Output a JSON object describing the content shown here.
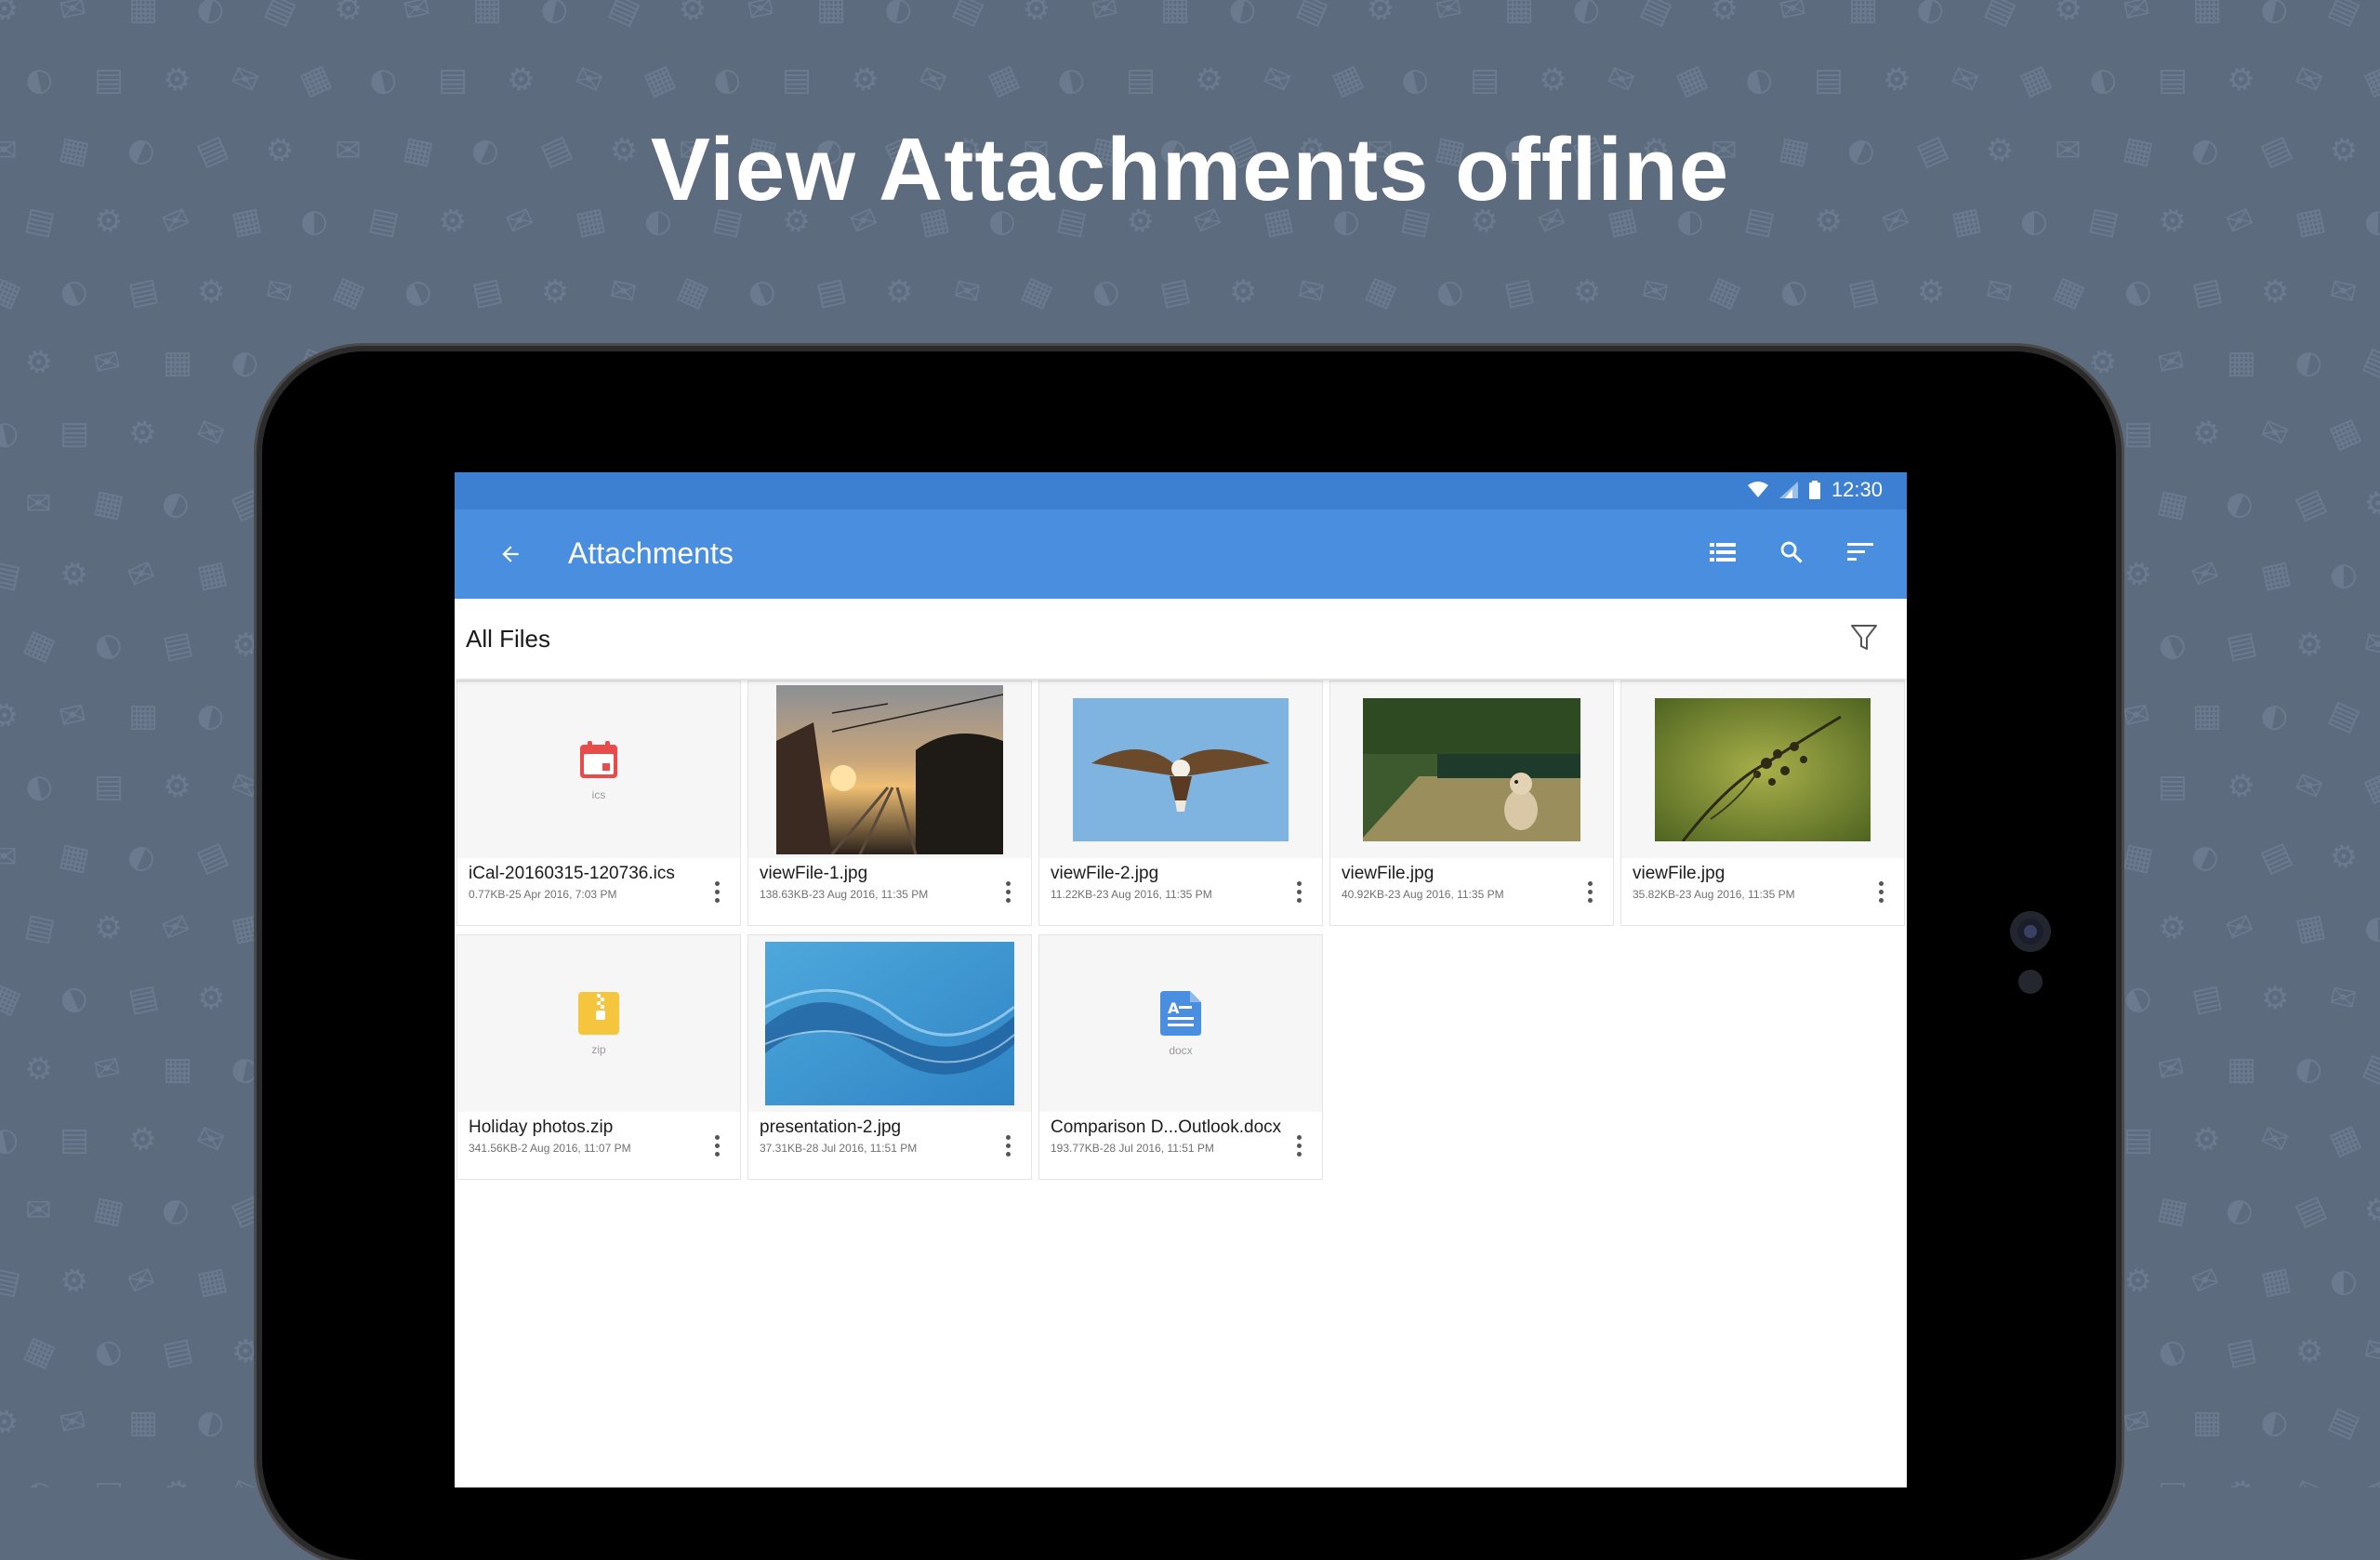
{
  "headline": "View Attachments offline",
  "status_bar": {
    "time": "12:30"
  },
  "app_bar": {
    "title": "Attachments",
    "icons": [
      "back-arrow-icon",
      "list-view-icon",
      "search-icon",
      "sort-icon"
    ]
  },
  "filter_bar": {
    "label": "All Files",
    "icon": "filter-icon"
  },
  "files": [
    {
      "name": "iCal-20160315-120736.ics",
      "meta": "0.77KB-25 Apr 2016, 7:03 PM",
      "kind": "icon",
      "ext": "ics",
      "icon": "calendar-icon",
      "color": "#e94b4b"
    },
    {
      "name": "viewFile-1.jpg",
      "meta": "138.63KB-23 Aug 2016, 11:35 PM",
      "kind": "image",
      "image": "sunset-railway"
    },
    {
      "name": "viewFile-2.jpg",
      "meta": "11.22KB-23 Aug 2016, 11:35 PM",
      "kind": "image",
      "image": "eagle-sky"
    },
    {
      "name": "viewFile.jpg",
      "meta": "40.92KB-23 Aug 2016, 11:35 PM",
      "kind": "image",
      "image": "dog-garden-path"
    },
    {
      "name": "viewFile.jpg",
      "meta": "35.82KB-23 Aug 2016, 11:35 PM",
      "kind": "image",
      "image": "plant-green"
    },
    {
      "name": "Holiday photos.zip",
      "meta": "341.56KB-2 Aug 2016, 11:07 PM",
      "kind": "icon",
      "ext": "zip",
      "icon": "zip-icon",
      "color": "#f4c53d"
    },
    {
      "name": "presentation-2.jpg",
      "meta": "37.31KB-28 Jul 2016, 11:51 PM",
      "kind": "image",
      "image": "blue-wave"
    },
    {
      "name": "Comparison D...Outlook.docx",
      "meta": "193.77KB-28 Jul 2016, 11:51 PM",
      "kind": "icon",
      "ext": "docx",
      "icon": "docx-icon",
      "color": "#4a8ee0"
    }
  ]
}
